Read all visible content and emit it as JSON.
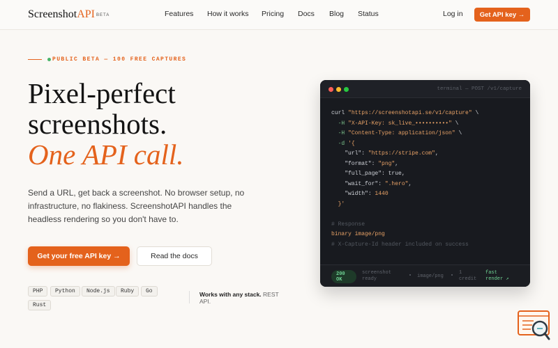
{
  "nav": {
    "logo_main": "Screenshot",
    "logo_api": "API",
    "logo_beta": "BETA",
    "links": [
      "Features",
      "How it works",
      "Pricing",
      "Docs",
      "Blog",
      "Status"
    ],
    "login": "Log in",
    "cta": "Get API key →"
  },
  "hero": {
    "badge": "PUBLIC BETA — 100 FREE CAPTURES",
    "title_line1": "Pixel-perfect",
    "title_line2": "screenshots.",
    "title_line3": "One API call.",
    "subtitle_lines": [
      "Send a URL, get back a screenshot. No browser setup, no",
      "infrastructure, no flakiness. ScreenshotAPI handles the",
      "headless rendering so you don't have to."
    ],
    "primary_button": "Get your free API key →",
    "secondary_button": "Read the docs",
    "languages": [
      "PHP",
      "Python",
      "Node.js",
      "Ruby",
      "Go",
      "Rust"
    ],
    "stack_note_bold": "Works with any stack.",
    "stack_note_rest": "REST API."
  },
  "terminal": {
    "title": "terminal — POST /v1/capture",
    "code": {
      "curl": "curl",
      "url": "\"https://screenshotapi.se/v1/capture\"",
      "bs": "\\",
      "h_flag": "-H",
      "auth_header": "\"X-API-Key: sk_live_••••••••••\"",
      "ct_header": "\"Content-Type: application/json\"",
      "d_flag": "-d",
      "open": "'{",
      "keys": [
        "\"url\"",
        "\"format\"",
        "\"full_page\"",
        "\"wait_for\"",
        "\"width\""
      ],
      "values": [
        "\"https://stripe.com\"",
        "\"png\"",
        "true",
        "\".hero\"",
        "1440"
      ],
      "close": "}'",
      "comment_response": "# Response",
      "response_type": "binary image/png",
      "comment_header": "# X-Capture-Id header included on success"
    },
    "footer": {
      "status_code": "200",
      "status_text": "OK",
      "ready_line1": "screenshot",
      "ready_line2": "ready",
      "mime": "image/png",
      "credit_line1": "1",
      "credit_line2": "credit",
      "render_line1": "fast",
      "render_line2": "render ↗"
    }
  },
  "colors": {
    "accent": "#e4621c",
    "success": "#6fd394",
    "terminal_bg": "#181a1f"
  },
  "icons": {
    "corner_widget": "chat-search-icon"
  }
}
